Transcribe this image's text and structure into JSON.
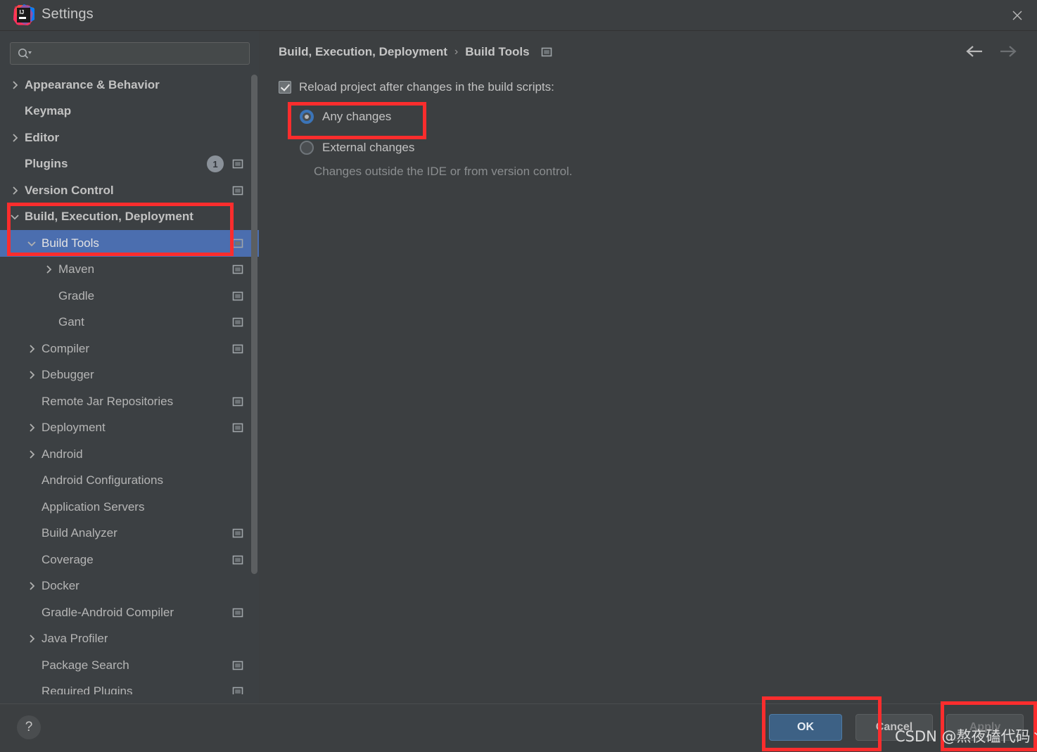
{
  "window": {
    "title": "Settings",
    "logo_icon": "intellij-idea-logo",
    "close_icon": "close-icon"
  },
  "search": {
    "value": "",
    "placeholder": "",
    "icon": "search-icon"
  },
  "sidebar": {
    "items": [
      {
        "label": "Appearance & Behavior",
        "indent": 0,
        "arrow": "chevron-right",
        "bold": true,
        "badge": null,
        "gear": false,
        "selected": false
      },
      {
        "label": "Keymap",
        "indent": 0,
        "arrow": "none",
        "bold": true,
        "badge": null,
        "gear": false,
        "selected": false
      },
      {
        "label": "Editor",
        "indent": 0,
        "arrow": "chevron-right",
        "bold": true,
        "badge": null,
        "gear": false,
        "selected": false
      },
      {
        "label": "Plugins",
        "indent": 0,
        "arrow": "none",
        "bold": true,
        "badge": "1",
        "gear": true,
        "selected": false
      },
      {
        "label": "Version Control",
        "indent": 0,
        "arrow": "chevron-right",
        "bold": true,
        "badge": null,
        "gear": true,
        "selected": false
      },
      {
        "label": "Build, Execution, Deployment",
        "indent": 0,
        "arrow": "chevron-down",
        "bold": true,
        "badge": null,
        "gear": false,
        "selected": false
      },
      {
        "label": "Build Tools",
        "indent": 1,
        "arrow": "chevron-down",
        "bold": false,
        "badge": null,
        "gear": true,
        "selected": true
      },
      {
        "label": "Maven",
        "indent": 2,
        "arrow": "chevron-right",
        "bold": false,
        "badge": null,
        "gear": true,
        "selected": false
      },
      {
        "label": "Gradle",
        "indent": 2,
        "arrow": "none",
        "bold": false,
        "badge": null,
        "gear": true,
        "selected": false
      },
      {
        "label": "Gant",
        "indent": 2,
        "arrow": "none",
        "bold": false,
        "badge": null,
        "gear": true,
        "selected": false
      },
      {
        "label": "Compiler",
        "indent": 1,
        "arrow": "chevron-right",
        "bold": false,
        "badge": null,
        "gear": true,
        "selected": false
      },
      {
        "label": "Debugger",
        "indent": 1,
        "arrow": "chevron-right",
        "bold": false,
        "badge": null,
        "gear": false,
        "selected": false
      },
      {
        "label": "Remote Jar Repositories",
        "indent": 1,
        "arrow": "none",
        "bold": false,
        "badge": null,
        "gear": true,
        "selected": false
      },
      {
        "label": "Deployment",
        "indent": 1,
        "arrow": "chevron-right",
        "bold": false,
        "badge": null,
        "gear": true,
        "selected": false
      },
      {
        "label": "Android",
        "indent": 1,
        "arrow": "chevron-right",
        "bold": false,
        "badge": null,
        "gear": false,
        "selected": false
      },
      {
        "label": "Android Configurations",
        "indent": 1,
        "arrow": "none",
        "bold": false,
        "badge": null,
        "gear": false,
        "selected": false
      },
      {
        "label": "Application Servers",
        "indent": 1,
        "arrow": "none",
        "bold": false,
        "badge": null,
        "gear": false,
        "selected": false
      },
      {
        "label": "Build Analyzer",
        "indent": 1,
        "arrow": "none",
        "bold": false,
        "badge": null,
        "gear": true,
        "selected": false
      },
      {
        "label": "Coverage",
        "indent": 1,
        "arrow": "none",
        "bold": false,
        "badge": null,
        "gear": true,
        "selected": false
      },
      {
        "label": "Docker",
        "indent": 1,
        "arrow": "chevron-right",
        "bold": false,
        "badge": null,
        "gear": false,
        "selected": false
      },
      {
        "label": "Gradle-Android Compiler",
        "indent": 1,
        "arrow": "none",
        "bold": false,
        "badge": null,
        "gear": true,
        "selected": false
      },
      {
        "label": "Java Profiler",
        "indent": 1,
        "arrow": "chevron-right",
        "bold": false,
        "badge": null,
        "gear": false,
        "selected": false
      },
      {
        "label": "Package Search",
        "indent": 1,
        "arrow": "none",
        "bold": false,
        "badge": null,
        "gear": true,
        "selected": false
      },
      {
        "label": "Required Plugins",
        "indent": 1,
        "arrow": "none",
        "bold": false,
        "badge": null,
        "gear": true,
        "selected": false
      }
    ]
  },
  "main": {
    "breadcrumb": {
      "parent": "Build, Execution, Deployment",
      "separator": "›",
      "current": "Build Tools",
      "icon": "settings-window-icon"
    },
    "nav": {
      "back_icon": "arrow-left-icon",
      "forward_icon": "arrow-right-icon"
    },
    "reload_option": {
      "label": "Reload project after changes in the build scripts:",
      "checked": true
    },
    "radio_options": [
      {
        "label": "Any changes",
        "selected": true
      },
      {
        "label": "External changes",
        "selected": false
      }
    ],
    "hint": "Changes outside the IDE or from version control."
  },
  "footer": {
    "help_label": "?",
    "buttons": [
      {
        "id": "ok",
        "label": "OK",
        "style": "primary",
        "enabled": true
      },
      {
        "id": "cancel",
        "label": "Cancel",
        "style": "default",
        "enabled": true
      },
      {
        "id": "apply",
        "label": "Apply",
        "style": "disabled",
        "enabled": false
      }
    ]
  },
  "watermark": "CSDN @熬夜磕代码丶",
  "colors": {
    "accent_selection": "#4b6eaf",
    "annotation_red": "#fb2d2d",
    "primary_button": "#3d6185",
    "radio_ring": "#3b74b8",
    "window_bg": "#3c3f41",
    "sidebar_bg": "#3c4043"
  }
}
